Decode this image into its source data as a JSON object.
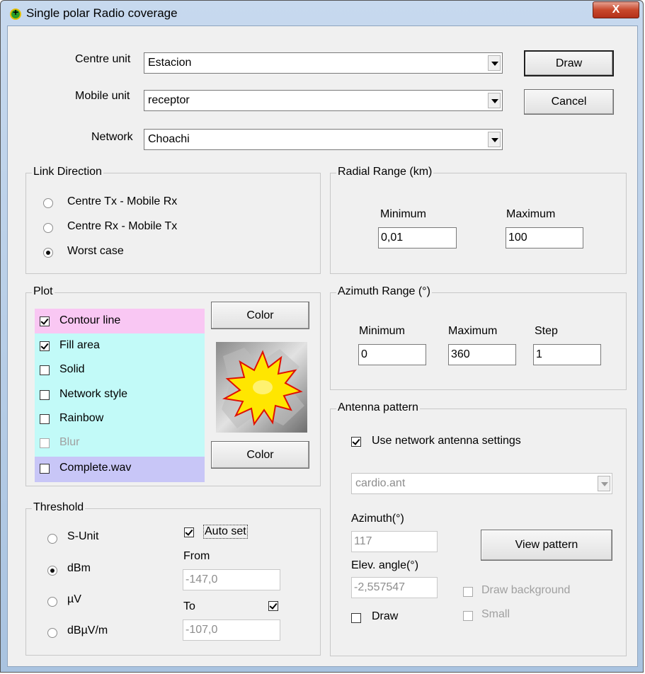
{
  "window": {
    "title": "Single polar Radio coverage",
    "close_label": "X"
  },
  "top": {
    "centre_unit": {
      "label": "Centre unit",
      "value": "Estacion"
    },
    "mobile_unit": {
      "label": "Mobile unit",
      "value": "receptor"
    },
    "network": {
      "label": "Network",
      "value": "Choachi"
    },
    "draw_label": "Draw",
    "cancel_label": "Cancel"
  },
  "link_direction": {
    "title": "Link Direction",
    "options": [
      "Centre Tx - Mobile Rx",
      "Centre Rx - Mobile Tx",
      "Worst case"
    ],
    "selected": "Worst case"
  },
  "radial_range": {
    "title": "Radial Range (km)",
    "min_label": "Minimum",
    "min_value": "0,01",
    "max_label": "Maximum",
    "max_value": "100"
  },
  "plot": {
    "title": "Plot",
    "items": [
      {
        "label": "Contour line",
        "checked": true
      },
      {
        "label": "Fill area",
        "checked": true
      },
      {
        "label": "Solid",
        "checked": false
      },
      {
        "label": "Network style",
        "checked": false
      },
      {
        "label": "Rainbow",
        "checked": false
      },
      {
        "label": "Blur",
        "checked": false,
        "disabled": true
      },
      {
        "label": "Complete.wav",
        "checked": false
      }
    ],
    "color_label_1": "Color",
    "color_label_2": "Color",
    "colors": {
      "contour_band": "#f9c7f3",
      "fill_band": "#c2faf8",
      "wav_band": "#c8c6f7",
      "fill": "#ffe600",
      "contour": "#e01000"
    }
  },
  "azimuth_range": {
    "title": "Azimuth Range (°)",
    "min_label": "Minimum",
    "min_value": "0",
    "max_label": "Maximum",
    "max_value": "360",
    "step_label": "Step",
    "step_value": "1"
  },
  "threshold": {
    "title": "Threshold",
    "options": [
      "S-Unit",
      "dBm",
      "µV",
      "dBµV/m"
    ],
    "selected": "dBm",
    "auto_set_label": "Auto set",
    "auto_set_checked": true,
    "from_label": "From",
    "from_value": "-147,0",
    "to_label": "To",
    "to_checked": true,
    "to_value": "-107,0"
  },
  "antenna": {
    "title": "Antenna pattern",
    "use_network_label": "Use network antenna settings",
    "use_network_checked": true,
    "pattern_file": "cardio.ant",
    "azimuth_label": "Azimuth(°)",
    "azimuth_value": "117",
    "elev_label": "Elev. angle(°)",
    "elev_value": "-2,557547",
    "view_pattern_label": "View pattern",
    "draw_background_label": "Draw background",
    "small_label": "Small",
    "draw_label": "Draw"
  }
}
